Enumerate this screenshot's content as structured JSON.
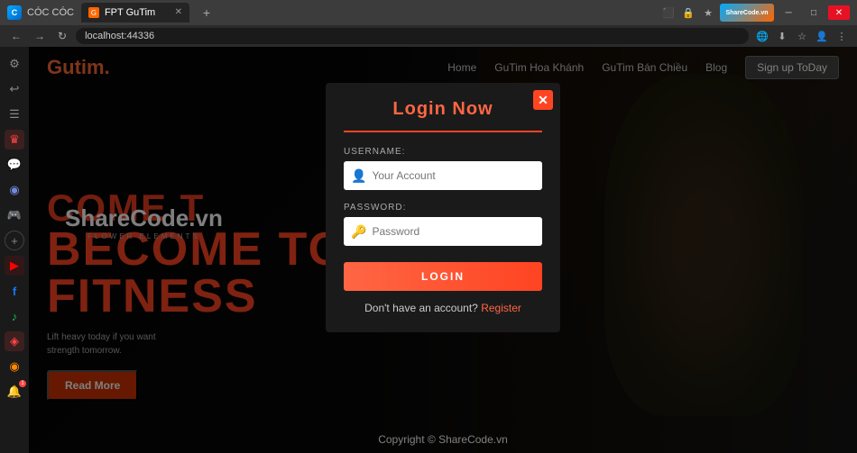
{
  "browser": {
    "coc_coc_label": "CÓC CÓC",
    "tab_title": "FPT GuTim",
    "new_tab_icon": "+",
    "address": "localhost:44336",
    "minimize_icon": "─",
    "maximize_icon": "□",
    "close_icon": "✕"
  },
  "sidebar_icons": [
    {
      "id": "settings",
      "icon": "⚙",
      "class": ""
    },
    {
      "id": "history",
      "icon": "↩",
      "class": ""
    },
    {
      "id": "notes",
      "icon": "☰",
      "class": ""
    },
    {
      "id": "crown",
      "icon": "♛",
      "class": "red"
    },
    {
      "id": "messenger",
      "icon": "💬",
      "class": "blue-messenger"
    },
    {
      "id": "discord",
      "icon": "◉",
      "class": "discord"
    },
    {
      "id": "game",
      "icon": "🎮",
      "class": ""
    },
    {
      "id": "add",
      "icon": "+",
      "class": "add-btn"
    },
    {
      "id": "youtube",
      "icon": "▶",
      "class": "youtube"
    },
    {
      "id": "facebook",
      "icon": "f",
      "class": "facebook"
    },
    {
      "id": "spotify",
      "icon": "♪",
      "class": "spotify"
    },
    {
      "id": "coc-icon",
      "icon": "🅒",
      "class": "red"
    },
    {
      "id": "coc-icon2",
      "icon": "◈",
      "class": "orange"
    },
    {
      "id": "notification",
      "icon": "🔔",
      "class": "notification",
      "badge": "1"
    }
  ],
  "site": {
    "logo_text": "Gu",
    "logo_highlight": "tim.",
    "nav_links": [
      {
        "label": "Home"
      },
      {
        "label": "GuTim Hoa Khánh"
      },
      {
        "label": "GuTim Bán Chiều"
      },
      {
        "label": "Blog"
      }
    ],
    "signup_btn": "Sign up ToDay",
    "watermark_main": "ShareCode.vn",
    "watermark_sub": "FLOWER ELEMENTS",
    "hero_line1": "COME T",
    "hero_line2": "BECOME TO",
    "hero_line3": "FITNESS",
    "hero_subtitle_1": "Lift heavy today if you want",
    "hero_subtitle_2": "strength tomorrow.",
    "read_more_btn": "Read More",
    "copyright": "Copyright © ShareCode.vn"
  },
  "modal": {
    "close_icon": "✕",
    "title": "Login Now",
    "divider": true,
    "username_label": "USERNAME:",
    "username_placeholder": "Your Account",
    "password_label": "PASSWORD:",
    "password_placeholder": "Password",
    "login_btn": "LOGIN",
    "no_account_text": "Don't have an account?",
    "register_link": "Register"
  }
}
